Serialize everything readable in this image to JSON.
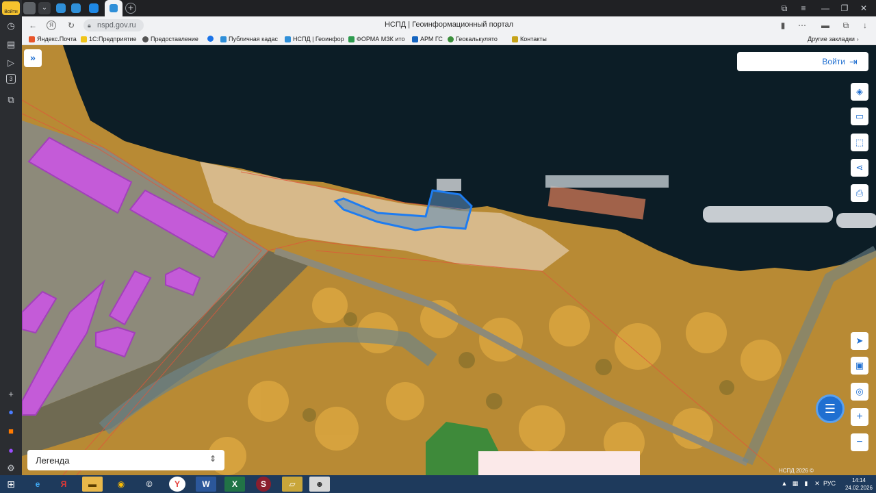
{
  "sidebar": {
    "login_badge": "Войти",
    "tab_count": "3"
  },
  "browser": {
    "url": "nspd.gov.ru",
    "title": "НСПД | Геоинформационный портал"
  },
  "bookmarks": {
    "items": [
      {
        "label": "Яндекс.Почта",
        "color": "#e8552b"
      },
      {
        "label": "1С:Предприятие",
        "color": "#f0c419"
      },
      {
        "label": "Предоставление",
        "color": "#555555"
      },
      {
        "label": "",
        "color": "#1a73e8"
      },
      {
        "label": "Публичная кадас",
        "color": "#2f8fd8"
      },
      {
        "label": "НСПД | Геоинфор",
        "color": "#2f8fd8"
      },
      {
        "label": "ФОРМА МЗК ито",
        "color": "#2e9b4f"
      },
      {
        "label": "АРМ ГС",
        "color": "#1565c0"
      },
      {
        "label": "Геокалькулято",
        "color": "#3c8f3c"
      },
      {
        "label": "Контакты",
        "color": "#c6a31a"
      }
    ],
    "other": "Другие закладки"
  },
  "map": {
    "login_label": "Войти",
    "legend_label": "Легенда",
    "copyright": "НСПД 2026 ©"
  },
  "taskbar": {
    "lang": "РУС",
    "time": "14:14",
    "date": "24.02.2026"
  }
}
